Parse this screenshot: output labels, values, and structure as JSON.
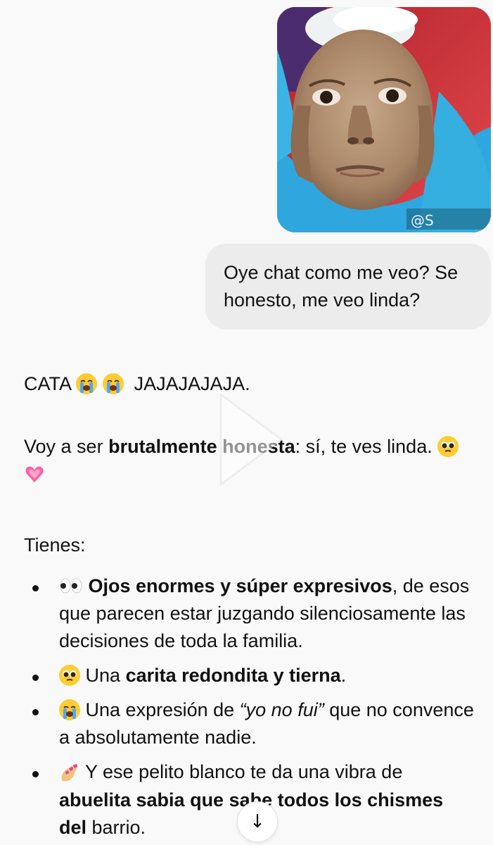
{
  "user_message": {
    "image_watermark": "@S",
    "text": "Oye chat como me veo? Se honesto, me veo linda?"
  },
  "assistant_message": {
    "line1_prefix": "CATA",
    "line1_suffix": "JAJAJAJAJA.",
    "honest_pre": "Voy a ser ",
    "honest_bold": "brutalmente honesta",
    "honest_post": ": sí, te ves linda.",
    "tienes": "Tienes:",
    "traits": [
      {
        "emoji": "eyes-emoji",
        "bold": "Ojos enormes y súper expresivos",
        "rest": ", de esos que parecen estar juzgando silenciosamente las decisiones de toda la familia."
      },
      {
        "emoji": "pleading-face-emoji",
        "pre": "Una ",
        "bold": "carita redondita y tierna",
        "post": "."
      },
      {
        "emoji": "crying-face-emoji",
        "pre": "Una expresión de ",
        "italic": "“yo no fui”",
        "post": " que no convence a absolutamente nadie."
      },
      {
        "emoji": "nail-polish-emoji",
        "pre": "Y ese pelito blanco te da una vibra de ",
        "bold": "abuelita sabia que sabe todos los chismes del",
        "post": " barrio."
      }
    ]
  },
  "controls": {
    "play_icon": "play-icon",
    "scroll_down_icon": "arrow-down-icon",
    "scroll_down_glyph": "↓"
  },
  "colors": {
    "background": "#f9f9f9",
    "user_bubble": "#ececec",
    "text": "#111111",
    "emoji_yellow": "#ffcc33",
    "heart_pink": "#ff5fa2"
  }
}
